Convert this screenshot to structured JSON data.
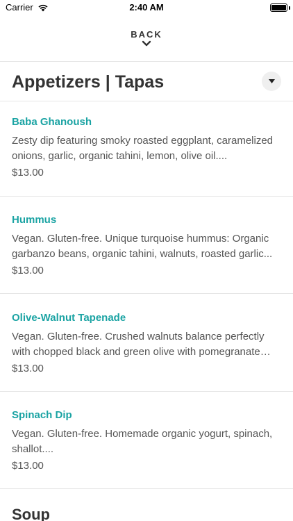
{
  "status_bar": {
    "carrier": "Carrier",
    "time": "2:40 AM"
  },
  "nav": {
    "back_label": "BACK"
  },
  "section": {
    "title": "Appetizers | Tapas"
  },
  "items": [
    {
      "name": "Baba Ghanoush",
      "description": "Zesty dip featuring smoky roasted eggplant, caramelized onions, garlic, organic tahini, lemon, olive oil....",
      "price": "$13.00"
    },
    {
      "name": "Hummus",
      "description": "Vegan. Gluten-free. Unique turquoise hummus: Organic garbanzo beans, organic tahini, walnuts, roasted garlic...",
      "price": "$13.00"
    },
    {
      "name": "Olive-Walnut Tapenade",
      "description": "Vegan. Gluten-free. Crushed walnuts balance perfectly with chopped black and green olive with pomegranate molasses...",
      "price": "$13.00"
    },
    {
      "name": "Spinach Dip",
      "description": "Vegan. Gluten-free. Homemade organic yogurt, spinach, shallot....",
      "price": "$13.00"
    }
  ],
  "next_section": {
    "title": "Soup"
  },
  "colors": {
    "accent": "#1aa3a3",
    "text": "#333333",
    "divider": "#e6e6e6"
  }
}
